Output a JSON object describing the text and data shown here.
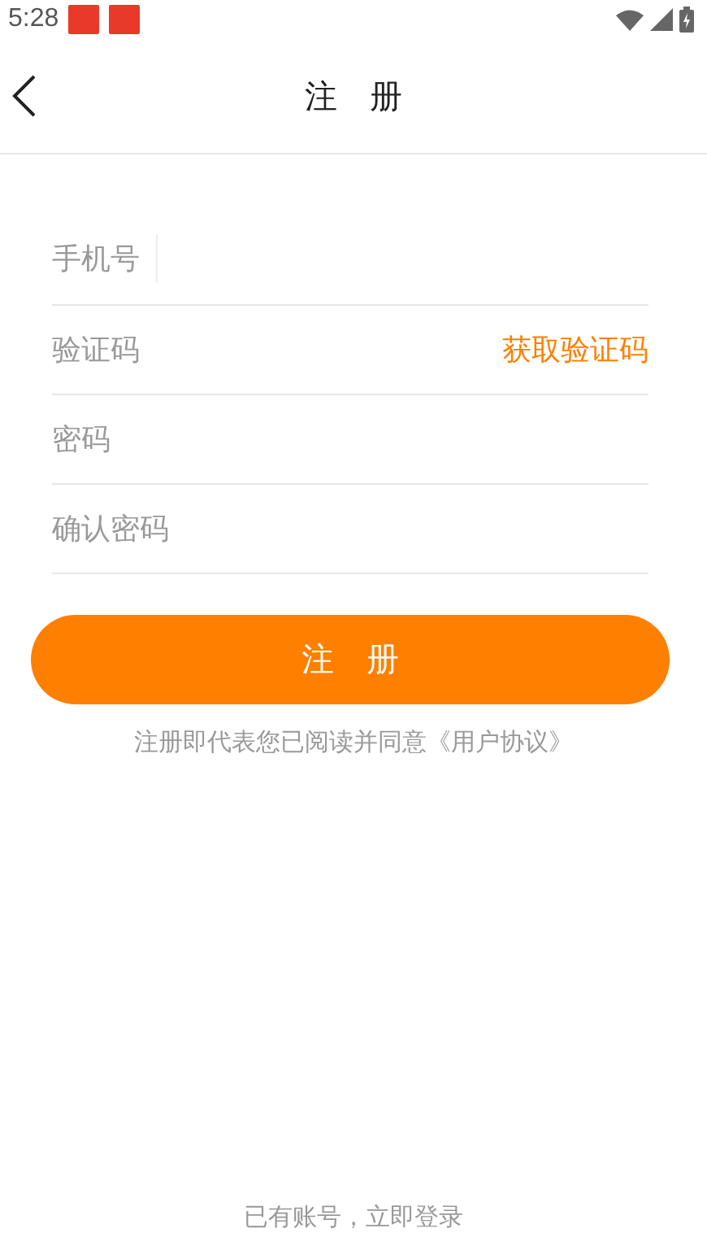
{
  "status_bar": {
    "time": "5:28"
  },
  "header": {
    "title": "注　册"
  },
  "fields": [
    {
      "placeholder": "手机号",
      "kind": "text"
    },
    {
      "placeholder": "验证码",
      "kind": "code",
      "action": "获取验证码"
    },
    {
      "placeholder": "密码",
      "kind": "password"
    },
    {
      "placeholder": "确认密码",
      "kind": "password"
    }
  ],
  "submit": {
    "label": "注　册"
  },
  "agreement": "注册即代表您已阅读并同意《用户协议》",
  "login_link": "已有账号，立即登录"
}
